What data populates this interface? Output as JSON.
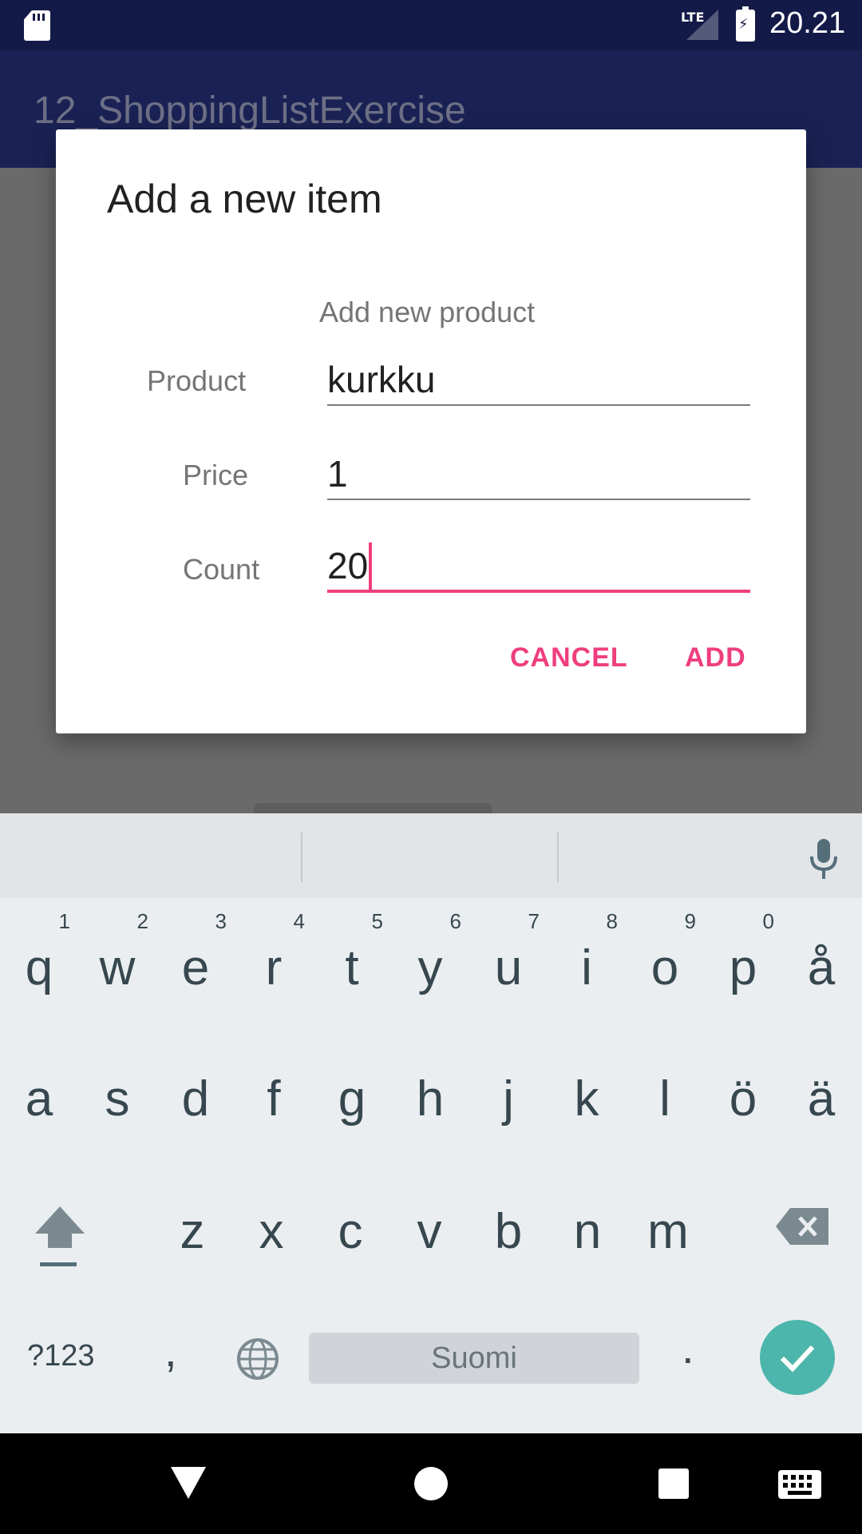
{
  "status_bar": {
    "network": "LTE",
    "time": "20.21"
  },
  "app_bar": {
    "title": "12_ShoppingListExercise"
  },
  "dialog": {
    "title": "Add a new item",
    "subtitle": "Add new product",
    "fields": [
      {
        "label": "Product",
        "value": "kurkku"
      },
      {
        "label": "Price",
        "value": "1"
      },
      {
        "label": "Count",
        "value": "20"
      }
    ],
    "cancel_label": "CANCEL",
    "add_label": "ADD"
  },
  "keyboard": {
    "row1": [
      {
        "key": "q",
        "hint": "1"
      },
      {
        "key": "w",
        "hint": "2"
      },
      {
        "key": "e",
        "hint": "3"
      },
      {
        "key": "r",
        "hint": "4"
      },
      {
        "key": "t",
        "hint": "5"
      },
      {
        "key": "y",
        "hint": "6"
      },
      {
        "key": "u",
        "hint": "7"
      },
      {
        "key": "i",
        "hint": "8"
      },
      {
        "key": "o",
        "hint": "9"
      },
      {
        "key": "p",
        "hint": "0"
      },
      {
        "key": "å",
        "hint": ""
      }
    ],
    "row2": [
      "a",
      "s",
      "d",
      "f",
      "g",
      "h",
      "j",
      "k",
      "l",
      "ö",
      "ä"
    ],
    "row3": [
      "z",
      "x",
      "c",
      "v",
      "b",
      "n",
      "m"
    ],
    "symbols_label": "?123",
    "comma": ",",
    "space_label": "Suomi",
    "period": "."
  },
  "colors": {
    "accent": "#ef3e7e",
    "status_bar": "#131a48",
    "app_bar": "#1a2255",
    "enter_key": "#4db6ac"
  },
  "icons": [
    "sd-card-icon",
    "signal-icon",
    "battery-icon",
    "mic-icon",
    "shift-icon",
    "backspace-icon",
    "globe-icon",
    "check-icon",
    "back-icon",
    "home-icon",
    "recents-icon",
    "keyboard-icon"
  ]
}
